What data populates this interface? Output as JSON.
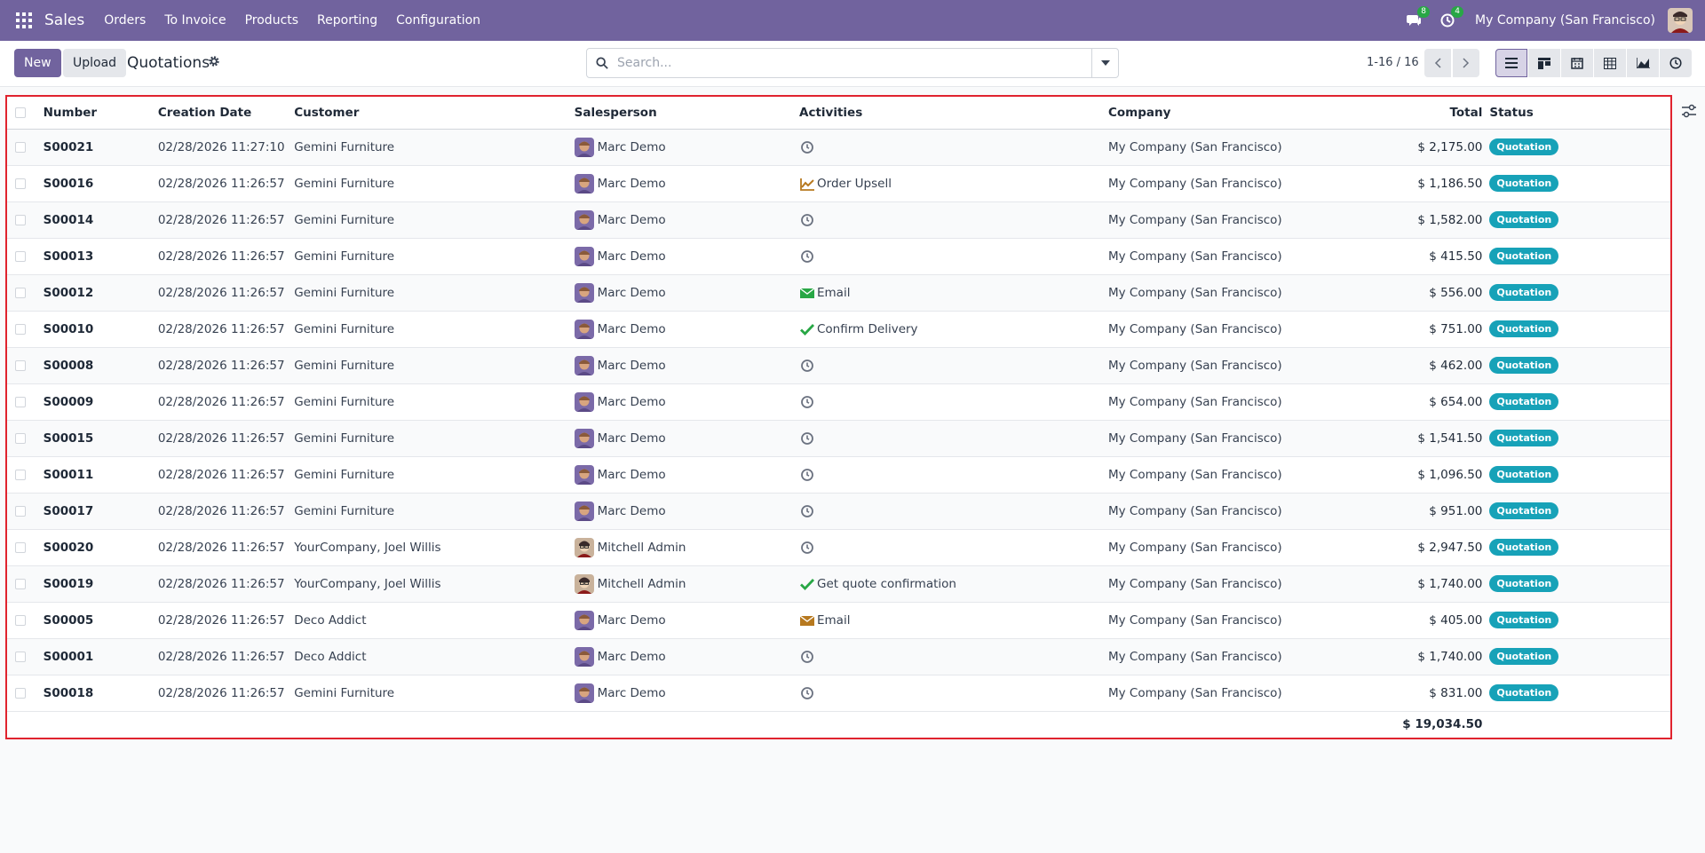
{
  "navbar": {
    "app_name": "Sales",
    "menu": [
      "Orders",
      "To Invoice",
      "Products",
      "Reporting",
      "Configuration"
    ],
    "messages_count": "8",
    "activities_count": "4",
    "company": "My Company (San Francisco)"
  },
  "control": {
    "new_label": "New",
    "upload_label": "Upload",
    "title": "Quotations",
    "search_placeholder": "Search...",
    "pager": "1-16 / 16",
    "views": [
      "list-view-icon",
      "kanban-view-icon",
      "calendar-view-icon",
      "pivot-view-icon",
      "graph-view-icon",
      "activity-view-icon"
    ]
  },
  "table": {
    "headers": {
      "number": "Number",
      "creation_date": "Creation Date",
      "customer": "Customer",
      "salesperson": "Salesperson",
      "activities": "Activities",
      "company": "Company",
      "total": "Total",
      "status": "Status"
    },
    "rows": [
      {
        "number": "S00021",
        "date": "02/28/2026 11:27:10",
        "customer": "Gemini Furniture",
        "salesperson": "Marc Demo",
        "activity_icon": "clock",
        "activity": "",
        "company": "My Company (San Francisco)",
        "total": "$ 2,175.00",
        "status": "Quotation"
      },
      {
        "number": "S00016",
        "date": "02/28/2026 11:26:57",
        "customer": "Gemini Furniture",
        "salesperson": "Marc Demo",
        "activity_icon": "chart",
        "activity": "Order Upsell",
        "company": "My Company (San Francisco)",
        "total": "$ 1,186.50",
        "status": "Quotation"
      },
      {
        "number": "S00014",
        "date": "02/28/2026 11:26:57",
        "customer": "Gemini Furniture",
        "salesperson": "Marc Demo",
        "activity_icon": "clock",
        "activity": "",
        "company": "My Company (San Francisco)",
        "total": "$ 1,582.00",
        "status": "Quotation"
      },
      {
        "number": "S00013",
        "date": "02/28/2026 11:26:57",
        "customer": "Gemini Furniture",
        "salesperson": "Marc Demo",
        "activity_icon": "clock",
        "activity": "",
        "company": "My Company (San Francisco)",
        "total": "$ 415.50",
        "status": "Quotation"
      },
      {
        "number": "S00012",
        "date": "02/28/2026 11:26:57",
        "customer": "Gemini Furniture",
        "salesperson": "Marc Demo",
        "activity_icon": "email-green",
        "activity": "Email",
        "company": "My Company (San Francisco)",
        "total": "$ 556.00",
        "status": "Quotation"
      },
      {
        "number": "S00010",
        "date": "02/28/2026 11:26:57",
        "customer": "Gemini Furniture",
        "salesperson": "Marc Demo",
        "activity_icon": "check",
        "activity": "Confirm Delivery",
        "company": "My Company (San Francisco)",
        "total": "$ 751.00",
        "status": "Quotation"
      },
      {
        "number": "S00008",
        "date": "02/28/2026 11:26:57",
        "customer": "Gemini Furniture",
        "salesperson": "Marc Demo",
        "activity_icon": "clock",
        "activity": "",
        "company": "My Company (San Francisco)",
        "total": "$ 462.00",
        "status": "Quotation"
      },
      {
        "number": "S00009",
        "date": "02/28/2026 11:26:57",
        "customer": "Gemini Furniture",
        "salesperson": "Marc Demo",
        "activity_icon": "clock",
        "activity": "",
        "company": "My Company (San Francisco)",
        "total": "$ 654.00",
        "status": "Quotation"
      },
      {
        "number": "S00015",
        "date": "02/28/2026 11:26:57",
        "customer": "Gemini Furniture",
        "salesperson": "Marc Demo",
        "activity_icon": "clock",
        "activity": "",
        "company": "My Company (San Francisco)",
        "total": "$ 1,541.50",
        "status": "Quotation"
      },
      {
        "number": "S00011",
        "date": "02/28/2026 11:26:57",
        "customer": "Gemini Furniture",
        "salesperson": "Marc Demo",
        "activity_icon": "clock",
        "activity": "",
        "company": "My Company (San Francisco)",
        "total": "$ 1,096.50",
        "status": "Quotation"
      },
      {
        "number": "S00017",
        "date": "02/28/2026 11:26:57",
        "customer": "Gemini Furniture",
        "salesperson": "Marc Demo",
        "activity_icon": "clock",
        "activity": "",
        "company": "My Company (San Francisco)",
        "total": "$ 951.00",
        "status": "Quotation"
      },
      {
        "number": "S00020",
        "date": "02/28/2026 11:26:57",
        "customer": "YourCompany, Joel Willis",
        "salesperson": "Mitchell Admin",
        "activity_icon": "clock",
        "activity": "",
        "company": "My Company (San Francisco)",
        "total": "$ 2,947.50",
        "status": "Quotation"
      },
      {
        "number": "S00019",
        "date": "02/28/2026 11:26:57",
        "customer": "YourCompany, Joel Willis",
        "salesperson": "Mitchell Admin",
        "activity_icon": "check",
        "activity": "Get quote confirmation",
        "company": "My Company (San Francisco)",
        "total": "$ 1,740.00",
        "status": "Quotation"
      },
      {
        "number": "S00005",
        "date": "02/28/2026 11:26:57",
        "customer": "Deco Addict",
        "salesperson": "Marc Demo",
        "activity_icon": "email-orange",
        "activity": "Email",
        "company": "My Company (San Francisco)",
        "total": "$ 405.00",
        "status": "Quotation"
      },
      {
        "number": "S00001",
        "date": "02/28/2026 11:26:57",
        "customer": "Deco Addict",
        "salesperson": "Marc Demo",
        "activity_icon": "clock",
        "activity": "",
        "company": "My Company (San Francisco)",
        "total": "$ 1,740.00",
        "status": "Quotation"
      },
      {
        "number": "S00018",
        "date": "02/28/2026 11:26:57",
        "customer": "Gemini Furniture",
        "salesperson": "Marc Demo",
        "activity_icon": "clock",
        "activity": "",
        "company": "My Company (San Francisco)",
        "total": "$ 831.00",
        "status": "Quotation"
      }
    ],
    "sum_total": "$ 19,034.50"
  },
  "colors": {
    "brand": "#71639e",
    "status_badge": "#17a2b8",
    "selection_outline": "#e0232e",
    "check_green": "#28a745",
    "chart_orange": "#b7791f"
  }
}
